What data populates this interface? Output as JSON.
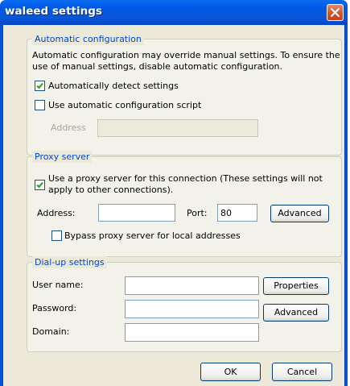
{
  "window": {
    "title": "waleed settings"
  },
  "automatic_configuration": {
    "legend": "Automatic configuration",
    "description": "Automatic configuration may override manual settings.  To ensure the use of manual settings, disable automatic configuration.",
    "description_line1": "Automatic configuration may override manual settings.  To ensure the",
    "description_line2": "use of manual settings, disable automatic configuration.",
    "auto_detect": {
      "label": "Automatically detect settings",
      "checked": true
    },
    "use_script": {
      "label": "Use automatic configuration script",
      "checked": false
    },
    "address_label": "Address",
    "address_value": ""
  },
  "proxy_server": {
    "legend": "Proxy server",
    "use_proxy": {
      "label_line1": "Use a proxy server for this connection (These settings will not",
      "label_line2": "apply to other connections).",
      "checked": true
    },
    "address_label": "Address:",
    "address_value": "",
    "port_label": "Port:",
    "port_value": "80",
    "advanced_label": "Advanced",
    "bypass": {
      "label": "Bypass proxy server for local addresses",
      "checked": false
    }
  },
  "dialup": {
    "legend": "Dial-up settings",
    "username_label": "User name:",
    "username_value": "",
    "password_label": "Password:",
    "password_value": "",
    "domain_label": "Domain:",
    "domain_value": "",
    "properties_label": "Properties",
    "advanced_label": "Advanced"
  },
  "footer": {
    "ok_label": "OK",
    "cancel_label": "Cancel"
  },
  "colors": {
    "title_bar": "#0058e6",
    "dialog_bg": "#ece9d8",
    "legend_text": "#0046d5",
    "close_button": "#d4502a"
  },
  "icons": {
    "close": "close-icon",
    "check": "checkmark-icon"
  }
}
